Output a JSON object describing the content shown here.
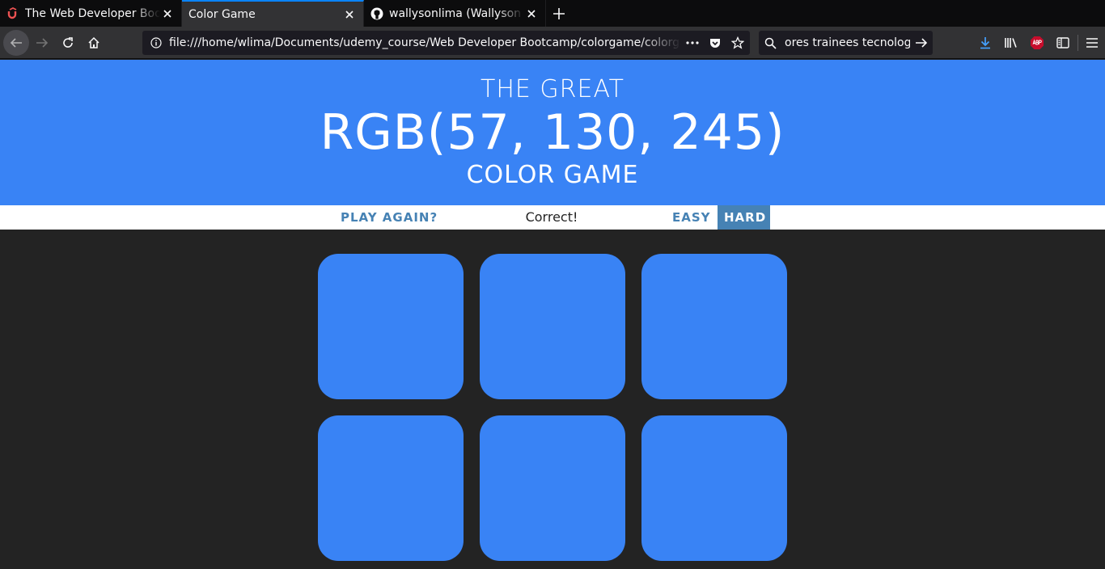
{
  "tabs": [
    {
      "title": "The Web Developer Bootcamp",
      "icon": "udemy-icon"
    },
    {
      "title": "Color Game",
      "icon": "none"
    },
    {
      "title": "wallysonlima (Wallyson Lima)",
      "icon": "github-icon"
    }
  ],
  "toolbar": {
    "url": "file:///home/wlima/Documents/udemy_course/Web Developer Bootcamp/colorgame/colorgame.html",
    "search_text": "ores trainees tecnologia"
  },
  "colors": {
    "header_bg": "#3983f5",
    "page_bg": "#232323",
    "accent": "#4682b4",
    "square": "#3983f5"
  },
  "game": {
    "title_line1": "THE GREAT",
    "color_display": "RGB(57, 130, 245)",
    "title_line3": "COLOR GAME",
    "reset_label": "PLAY AGAIN?",
    "message": "Correct!",
    "easy_label": "EASY",
    "hard_label": "HARD",
    "selected_mode": "HARD",
    "squares": [
      "#3983f5",
      "#3983f5",
      "#3983f5",
      "#3983f5",
      "#3983f5",
      "#3983f5"
    ]
  }
}
